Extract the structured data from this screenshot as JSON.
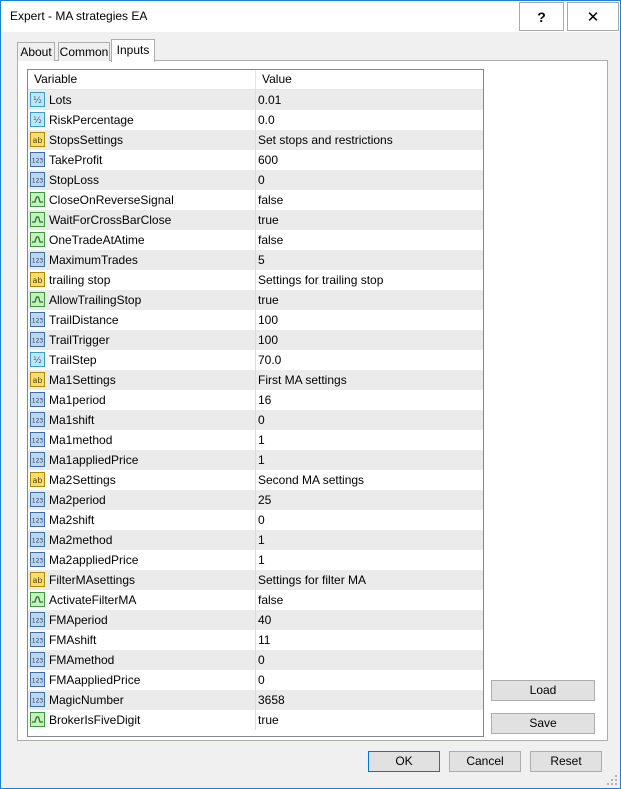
{
  "window": {
    "title": "Expert - MA strategies EA",
    "help_glyph": "?",
    "close_glyph": "✕"
  },
  "tabs": [
    {
      "label": "About",
      "active": false
    },
    {
      "label": "Common",
      "active": false
    },
    {
      "label": "Inputs",
      "active": true
    }
  ],
  "grid": {
    "col_variable": "Variable",
    "col_value": "Value",
    "rows": [
      {
        "icon": "double-icon",
        "name": "Lots",
        "value": "0.01"
      },
      {
        "icon": "double-icon",
        "name": "RiskPercentage",
        "value": "0.0"
      },
      {
        "icon": "string-icon",
        "name": "StopsSettings",
        "value": "Set stops and restrictions"
      },
      {
        "icon": "integer-icon",
        "name": "TakeProfit",
        "value": "600"
      },
      {
        "icon": "integer-icon",
        "name": "StopLoss",
        "value": "0"
      },
      {
        "icon": "bool-icon",
        "name": "CloseOnReverseSignal",
        "value": "false"
      },
      {
        "icon": "bool-icon",
        "name": "WaitForCrossBarClose",
        "value": "true"
      },
      {
        "icon": "bool-icon",
        "name": "OneTradeAtAtime",
        "value": "false"
      },
      {
        "icon": "integer-icon",
        "name": "MaximumTrades",
        "value": "5"
      },
      {
        "icon": "string-icon",
        "name": "trailing stop",
        "value": "Settings for trailing stop"
      },
      {
        "icon": "bool-icon",
        "name": "AllowTrailingStop",
        "value": "true"
      },
      {
        "icon": "integer-icon",
        "name": "TrailDistance",
        "value": "100"
      },
      {
        "icon": "integer-icon",
        "name": "TrailTrigger",
        "value": "100"
      },
      {
        "icon": "double-icon",
        "name": "TrailStep",
        "value": "70.0"
      },
      {
        "icon": "string-icon",
        "name": "Ma1Settings",
        "value": "First MA settings"
      },
      {
        "icon": "integer-icon",
        "name": "Ma1period",
        "value": "16"
      },
      {
        "icon": "integer-icon",
        "name": "Ma1shift",
        "value": "0"
      },
      {
        "icon": "integer-icon",
        "name": "Ma1method",
        "value": "1"
      },
      {
        "icon": "integer-icon",
        "name": "Ma1appliedPrice",
        "value": "1"
      },
      {
        "icon": "string-icon",
        "name": "Ma2Settings",
        "value": "Second MA settings"
      },
      {
        "icon": "integer-icon",
        "name": "Ma2period",
        "value": "25"
      },
      {
        "icon": "integer-icon",
        "name": "Ma2shift",
        "value": "0"
      },
      {
        "icon": "integer-icon",
        "name": "Ma2method",
        "value": "1"
      },
      {
        "icon": "integer-icon",
        "name": "Ma2appliedPrice",
        "value": "1"
      },
      {
        "icon": "string-icon",
        "name": "FilterMAsettings",
        "value": "Settings for filter MA"
      },
      {
        "icon": "bool-icon",
        "name": "ActivateFilterMA",
        "value": "false"
      },
      {
        "icon": "integer-icon",
        "name": "FMAperiod",
        "value": "40"
      },
      {
        "icon": "integer-icon",
        "name": "FMAshift",
        "value": "11"
      },
      {
        "icon": "integer-icon",
        "name": "FMAmethod",
        "value": "0"
      },
      {
        "icon": "integer-icon",
        "name": "FMAappliedPrice",
        "value": "0"
      },
      {
        "icon": "integer-icon",
        "name": "MagicNumber",
        "value": "3658"
      },
      {
        "icon": "bool-icon",
        "name": "BrokerIsFiveDigit",
        "value": "true"
      }
    ]
  },
  "side_buttons": {
    "load": "Load",
    "save": "Save"
  },
  "footer_buttons": {
    "ok": "OK",
    "cancel": "Cancel",
    "reset": "Reset"
  },
  "icon_glyphs": {
    "double": "½",
    "string": "ab",
    "integer": "123"
  },
  "colors": {
    "accent": "#0078d7",
    "border": "#1883d7",
    "row_alt": "#ebebeb"
  }
}
